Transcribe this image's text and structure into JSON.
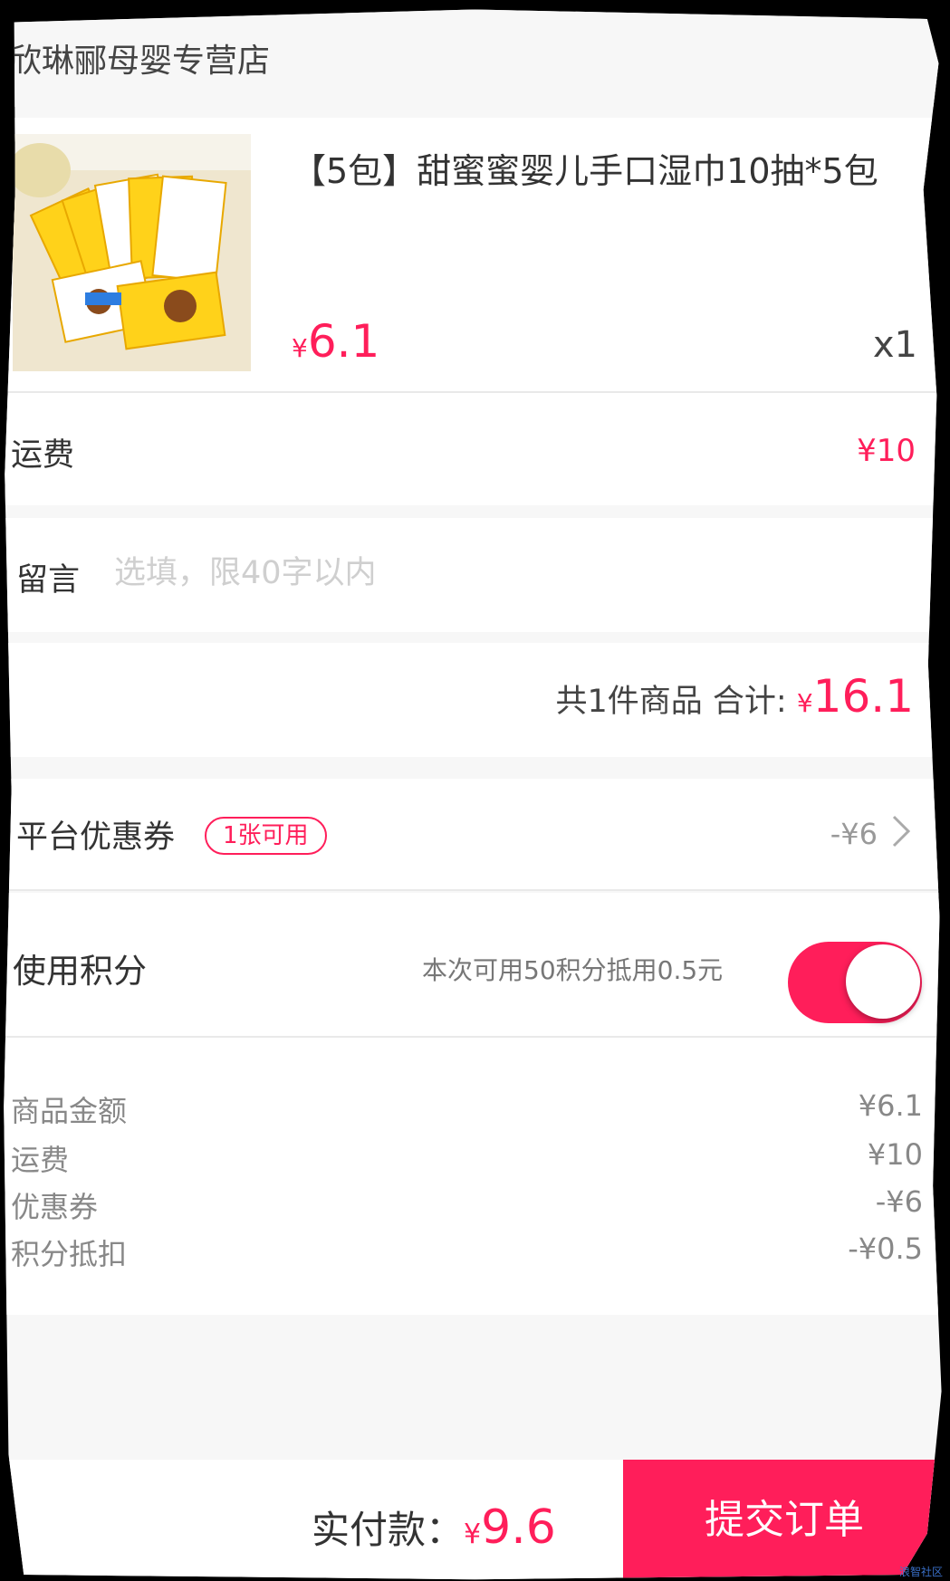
{
  "shop": {
    "name": "欣琳郦母婴专营店"
  },
  "product": {
    "title": "【5包】甜蜜蜜婴儿手口湿巾10抽*5包",
    "currency": "¥",
    "price": "6.1",
    "quantity": "x1"
  },
  "shipping": {
    "label": "运费",
    "value": "¥10"
  },
  "message": {
    "label": "留言",
    "placeholder": "选填，限40字以内",
    "value": ""
  },
  "total": {
    "count_text": "共1件商品 合计:",
    "currency": "¥",
    "amount": "16.1"
  },
  "coupon": {
    "label": "平台优惠券",
    "badge": "1张可用",
    "value": "-¥6"
  },
  "points": {
    "label": "使用积分",
    "hint": "本次可用50积分抵用0.5元",
    "enabled": true
  },
  "summary": [
    {
      "label": "商品金额",
      "value": "¥6.1"
    },
    {
      "label": "运费",
      "value": "¥10"
    },
    {
      "label": "优惠券",
      "value": "-¥6"
    },
    {
      "label": "积分抵扣",
      "value": "-¥0.5"
    }
  ],
  "footer": {
    "pay_label": "实付款：",
    "currency": "¥",
    "pay_amount": "9.6",
    "submit_label": "提交订单",
    "watermark": "浪智社区"
  },
  "colors": {
    "accent": "#ff1e5a",
    "background": "#f7f7f7"
  },
  "icons": {
    "coupon_arrow": "chevron-right-icon"
  }
}
